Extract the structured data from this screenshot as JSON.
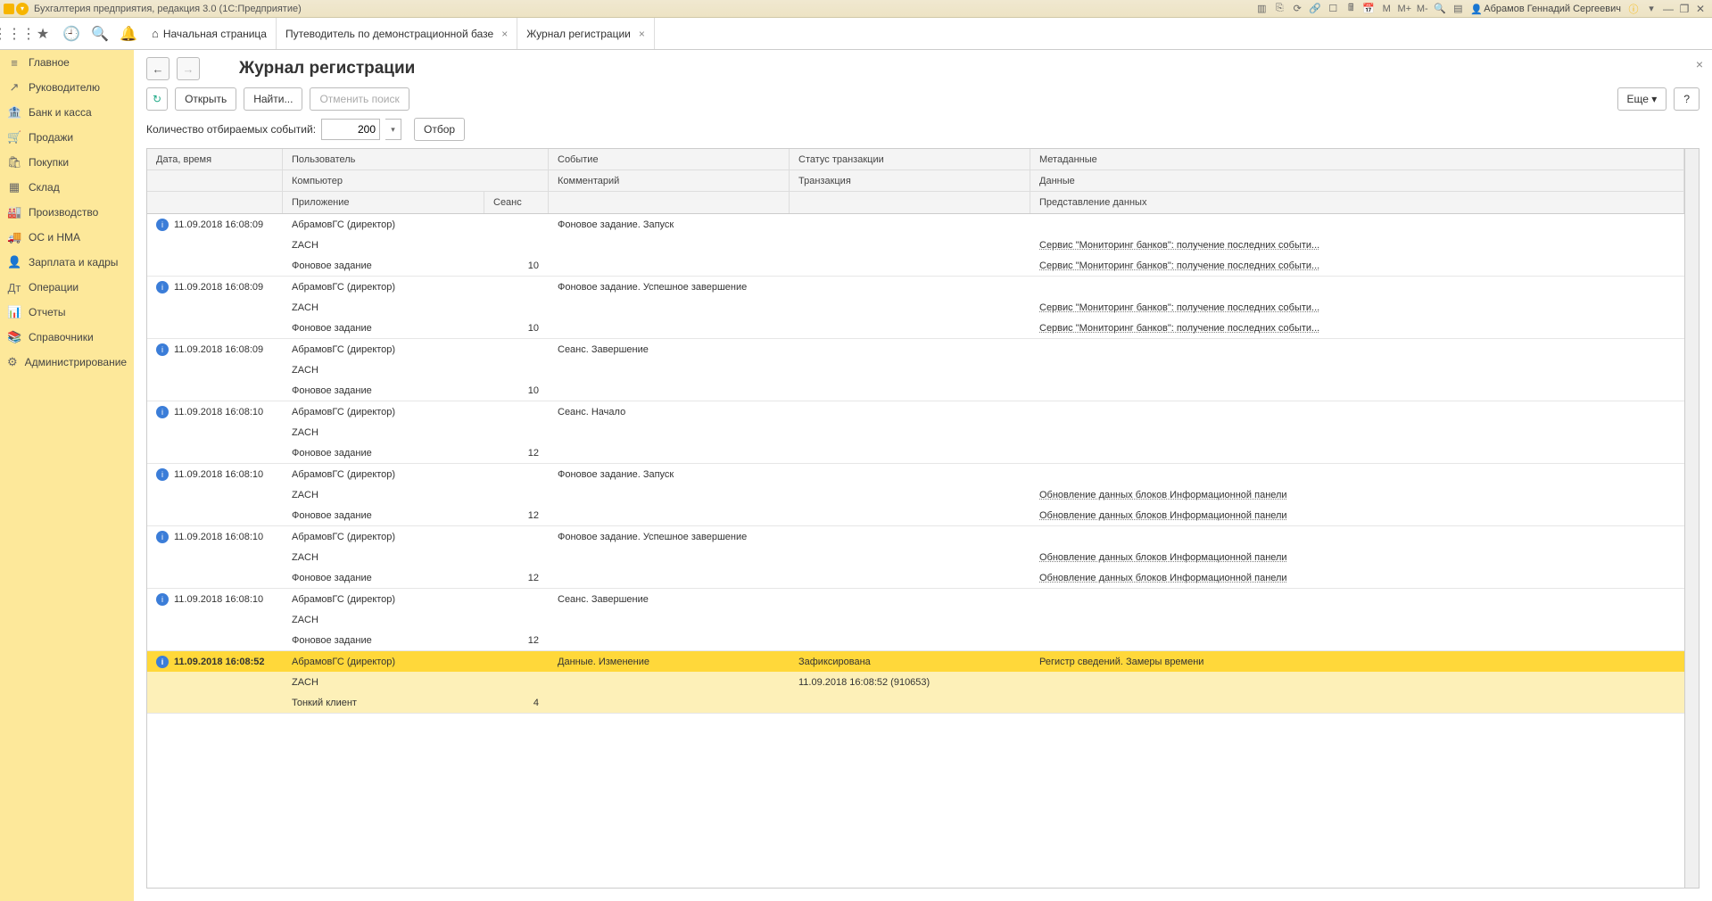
{
  "titlebar": {
    "app_title": "Бухгалтерия предприятия, редакция 3.0  (1С:Предприятие)",
    "user_name": "Абрамов Геннадий Сергеевич",
    "m_labels": [
      "M",
      "M+",
      "M-"
    ]
  },
  "toolbar": {
    "tabs": [
      {
        "label": "Начальная страница",
        "closable": false,
        "home": true
      },
      {
        "label": "Путеводитель по демонстрационной базе",
        "closable": true,
        "home": false
      },
      {
        "label": "Журнал регистрации",
        "closable": true,
        "home": false
      }
    ]
  },
  "sidebar": {
    "items": [
      {
        "icon": "≡",
        "label": "Главное"
      },
      {
        "icon": "↗",
        "label": "Руководителю"
      },
      {
        "icon": "🏦",
        "label": "Банк и касса"
      },
      {
        "icon": "🛒",
        "label": "Продажи"
      },
      {
        "icon": "🛍",
        "label": "Покупки"
      },
      {
        "icon": "▦",
        "label": "Склад"
      },
      {
        "icon": "🏭",
        "label": "Производство"
      },
      {
        "icon": "🚚",
        "label": "ОС и НМА"
      },
      {
        "icon": "👤",
        "label": "Зарплата и кадры"
      },
      {
        "icon": "Дт",
        "label": "Операции"
      },
      {
        "icon": "📊",
        "label": "Отчеты"
      },
      {
        "icon": "📚",
        "label": "Справочники"
      },
      {
        "icon": "⚙",
        "label": "Администрирование"
      }
    ]
  },
  "page": {
    "title": "Журнал регистрации",
    "nav_back": "←",
    "nav_fwd": "→",
    "close": "×"
  },
  "actions": {
    "refresh": "↻",
    "open": "Открыть",
    "find": "Найти...",
    "cancel_find": "Отменить поиск",
    "more": "Еще",
    "help": "?"
  },
  "filter": {
    "label": "Количество отбираемых событий:",
    "value": "200",
    "button": "Отбор"
  },
  "headers": {
    "r1": {
      "dt": "Дата, время",
      "user": "Пользователь",
      "evt": "Событие",
      "status": "Статус транзакции",
      "meta": "Метаданные"
    },
    "r2": {
      "comp": "Компьютер",
      "comment": "Комментарий",
      "trans": "Транзакция",
      "data": "Данные"
    },
    "r3": {
      "app": "Приложение",
      "sess": "Сеанс",
      "repr": "Представление данных"
    }
  },
  "rows": [
    {
      "dt": "11.09.2018 16:08:09",
      "user": "АбрамовГС (директор)",
      "evt": "Фоновое задание. Запуск",
      "status": "",
      "meta": "",
      "comp": "ZACH",
      "comment": "",
      "trans": "",
      "data": "Сервис \"Мониторинг банков\": получение последних событи...",
      "app": "Фоновое задание",
      "sess": "10",
      "repr": "Сервис \"Мониторинг банков\": получение последних событи...",
      "selected": false
    },
    {
      "dt": "11.09.2018 16:08:09",
      "user": "АбрамовГС (директор)",
      "evt": "Фоновое задание. Успешное завершение",
      "status": "",
      "meta": "",
      "comp": "ZACH",
      "comment": "",
      "trans": "",
      "data": "Сервис \"Мониторинг банков\": получение последних событи...",
      "app": "Фоновое задание",
      "sess": "10",
      "repr": "Сервис \"Мониторинг банков\": получение последних событи...",
      "selected": false
    },
    {
      "dt": "11.09.2018 16:08:09",
      "user": "АбрамовГС (директор)",
      "evt": "Сеанс. Завершение",
      "status": "",
      "meta": "",
      "comp": "ZACH",
      "comment": "",
      "trans": "",
      "data": "",
      "app": "Фоновое задание",
      "sess": "10",
      "repr": "",
      "selected": false
    },
    {
      "dt": "11.09.2018 16:08:10",
      "user": "АбрамовГС (директор)",
      "evt": "Сеанс. Начало",
      "status": "",
      "meta": "",
      "comp": "ZACH",
      "comment": "",
      "trans": "",
      "data": "",
      "app": "Фоновое задание",
      "sess": "12",
      "repr": "",
      "selected": false
    },
    {
      "dt": "11.09.2018 16:08:10",
      "user": "АбрамовГС (директор)",
      "evt": "Фоновое задание. Запуск",
      "status": "",
      "meta": "",
      "comp": "ZACH",
      "comment": "",
      "trans": "",
      "data": "Обновление данных блоков Информационной панели",
      "app": "Фоновое задание",
      "sess": "12",
      "repr": "Обновление данных блоков Информационной панели",
      "selected": false
    },
    {
      "dt": "11.09.2018 16:08:10",
      "user": "АбрамовГС (директор)",
      "evt": "Фоновое задание. Успешное завершение",
      "status": "",
      "meta": "",
      "comp": "ZACH",
      "comment": "",
      "trans": "",
      "data": "Обновление данных блоков Информационной панели",
      "app": "Фоновое задание",
      "sess": "12",
      "repr": "Обновление данных блоков Информационной панели",
      "selected": false
    },
    {
      "dt": "11.09.2018 16:08:10",
      "user": "АбрамовГС (директор)",
      "evt": "Сеанс. Завершение",
      "status": "",
      "meta": "",
      "comp": "ZACH",
      "comment": "",
      "trans": "",
      "data": "",
      "app": "Фоновое задание",
      "sess": "12",
      "repr": "",
      "selected": false
    },
    {
      "dt": "11.09.2018 16:08:52",
      "user": "АбрамовГС (директор)",
      "evt": "Данные. Изменение",
      "status": "Зафиксирована",
      "meta": "Регистр сведений. Замеры времени",
      "comp": "ZACH",
      "comment": "",
      "trans": "11.09.2018 16:08:52 (910653)",
      "data": "",
      "app": "Тонкий клиент",
      "sess": "4",
      "repr": "",
      "selected": true
    }
  ]
}
